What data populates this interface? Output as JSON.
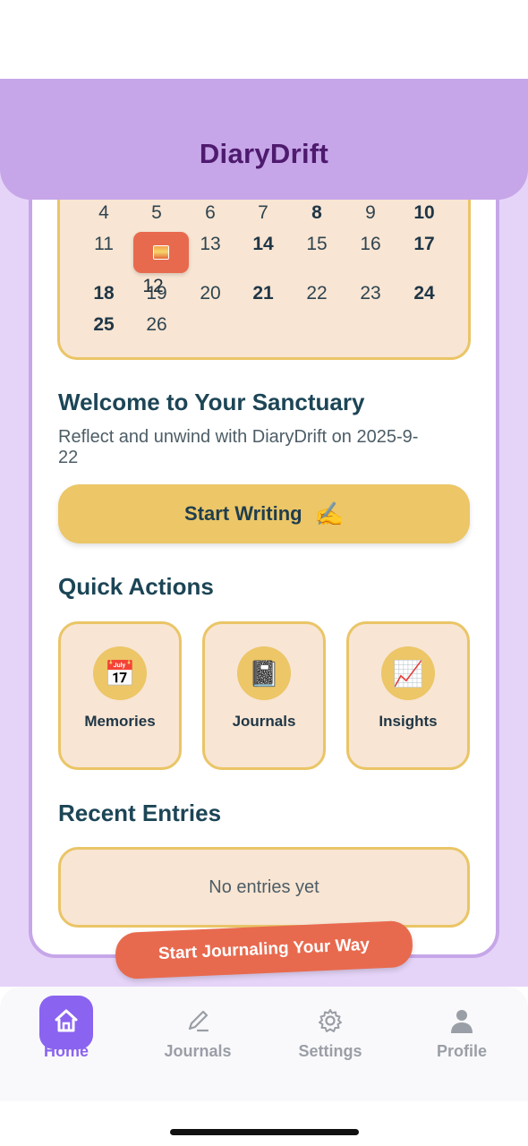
{
  "app": {
    "title": "DiaryDrift"
  },
  "calendar": {
    "rows": [
      [
        {
          "d": "4"
        },
        {
          "d": "5"
        },
        {
          "d": "6"
        },
        {
          "d": "7"
        },
        {
          "d": "8",
          "bold": true
        },
        {
          "d": "9"
        },
        {
          "d": "10",
          "bold": true
        }
      ],
      [
        {
          "d": "11"
        },
        {
          "d": ""
        },
        {
          "d": "13"
        },
        {
          "d": "14",
          "bold": true
        },
        {
          "d": "15"
        },
        {
          "d": "16"
        },
        {
          "d": "17",
          "bold": true
        }
      ],
      [
        {
          "d": "18",
          "bold": true
        },
        {
          "d": "19"
        },
        {
          "d": "20"
        },
        {
          "d": "21",
          "bold": true
        },
        {
          "d": "22"
        },
        {
          "d": "23"
        },
        {
          "d": "24",
          "bold": true
        }
      ],
      [
        {
          "d": "25",
          "bold": true
        },
        {
          "d": "26"
        }
      ]
    ],
    "today": "12"
  },
  "welcome": {
    "title": "Welcome to Your Sanctuary",
    "text": "Reflect and unwind with DiaryDrift on 2025-9-22"
  },
  "start_button": {
    "label": "Start Writing",
    "icon": "✍️"
  },
  "quick_actions": {
    "title": "Quick Actions",
    "items": [
      {
        "label": "Memories",
        "icon": "📅"
      },
      {
        "label": "Journals",
        "icon": "📓"
      },
      {
        "label": "Insights",
        "icon": "📈"
      }
    ]
  },
  "recent": {
    "title": "Recent Entries",
    "empty_text": "No entries yet"
  },
  "banner": {
    "text": "Start Journaling Your Way"
  },
  "tabs": [
    {
      "label": "Home",
      "icon": "home-icon",
      "active": true
    },
    {
      "label": "Journals",
      "icon": "pencil-icon"
    },
    {
      "label": "Settings",
      "icon": "gear-icon"
    },
    {
      "label": "Profile",
      "icon": "person-icon"
    }
  ],
  "colors": {
    "header": "#c6a6e8",
    "title": "#4e1a6e",
    "accent": "#ecc667",
    "card_fill": "#f8e5d3",
    "banner": "#e86a4e",
    "tab_active": "#8a63f0"
  }
}
